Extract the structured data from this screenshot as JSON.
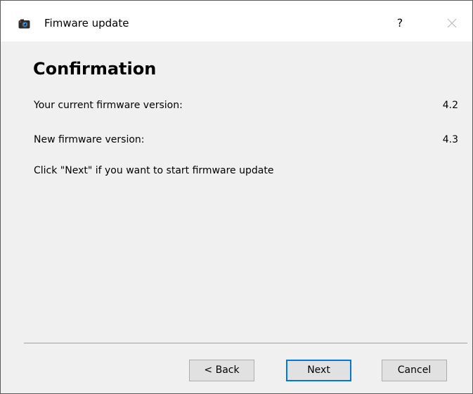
{
  "window": {
    "title": "Fimware update",
    "help_label": "?"
  },
  "page": {
    "heading": "Confirmation",
    "current_version_label": "Your current firmware version:",
    "current_version_value": "4.2",
    "new_version_label": "New firmware version:",
    "new_version_value": "4.3",
    "instruction": "Click \"Next\" if you want to start firmware update"
  },
  "buttons": {
    "back": "< Back",
    "next": "Next",
    "cancel": "Cancel"
  },
  "colors": {
    "accent": "#0078d7",
    "dialog_bg": "#f0f0f0"
  },
  "icons": {
    "app": "camera-icon",
    "close": "close-icon"
  }
}
